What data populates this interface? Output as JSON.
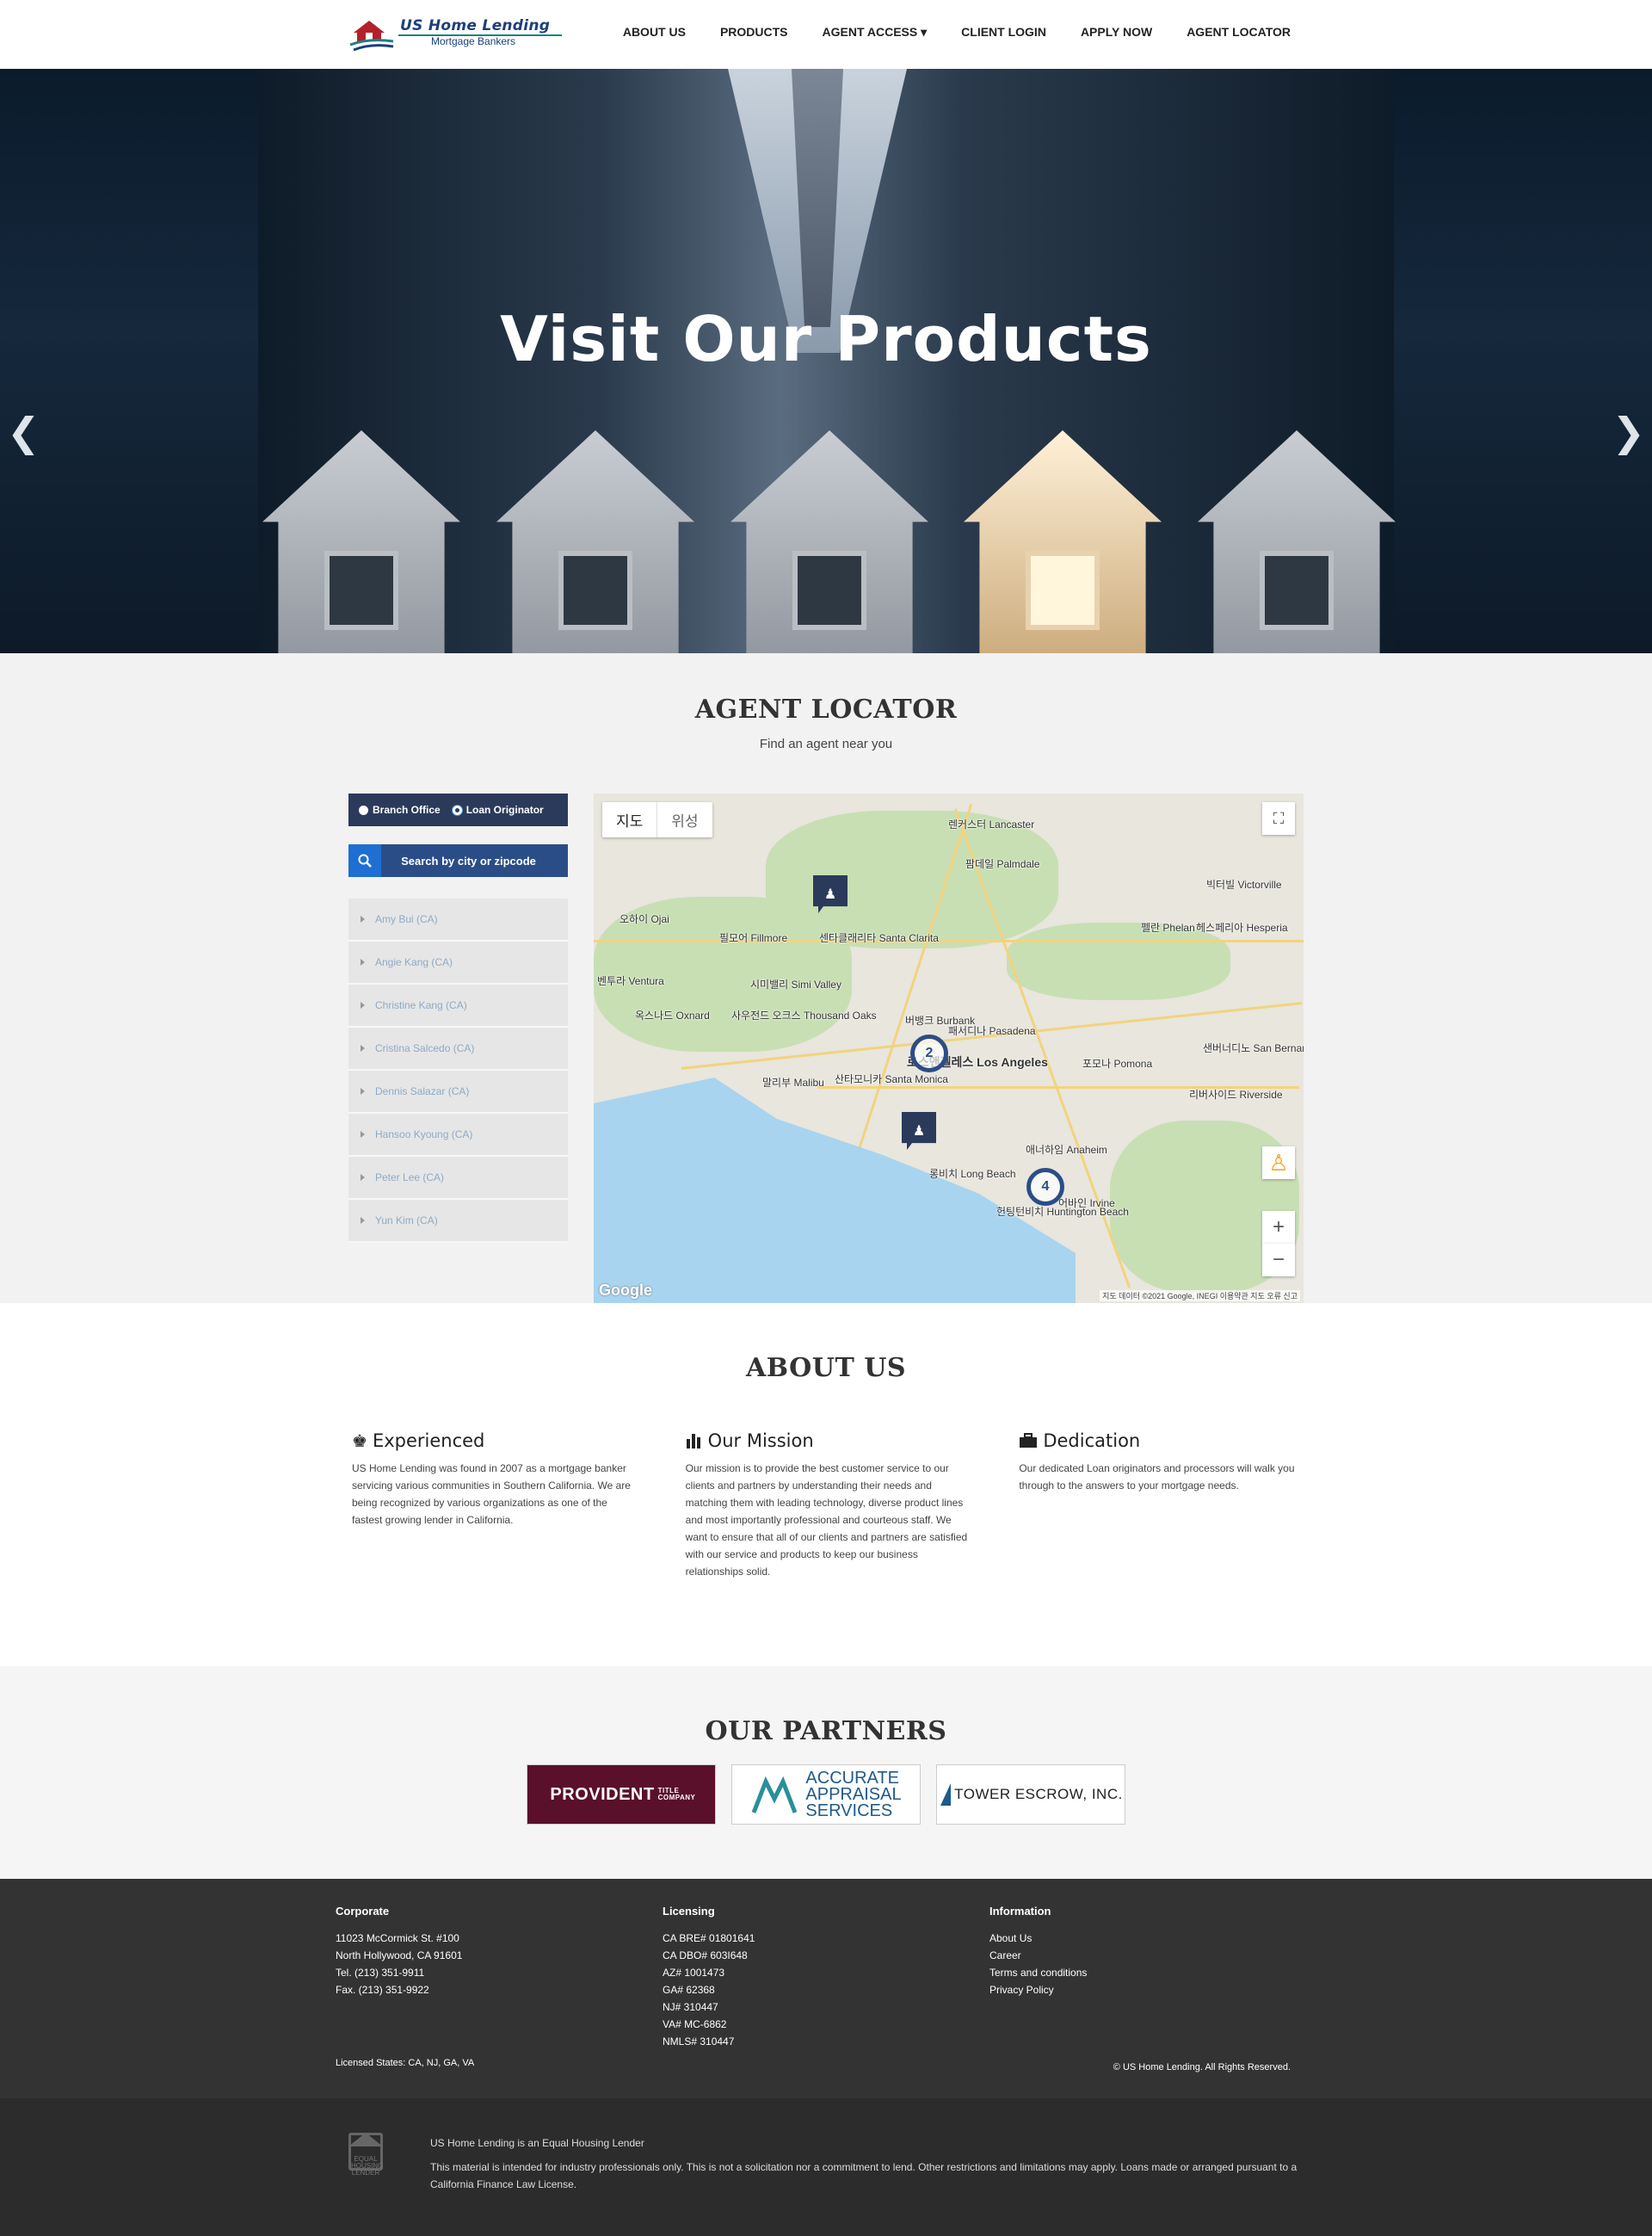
{
  "brand": {
    "title": "US Home Lending",
    "subtitle": "Mortgage Bankers"
  },
  "nav": {
    "items": [
      "ABOUT US",
      "PRODUCTS",
      "AGENT ACCESS ▾",
      "CLIENT LOGIN",
      "APPLY NOW",
      "AGENT LOCATOR"
    ]
  },
  "hero": {
    "title": "Visit Our Products",
    "prev_icon": "chevron-left-icon",
    "next_icon": "chevron-right-icon"
  },
  "locator": {
    "title": "AGENT LOCATOR",
    "subtitle": "Find an agent near you",
    "radio": [
      {
        "label": "Branch Office",
        "selected": false
      },
      {
        "label": "Loan Originator",
        "selected": true
      }
    ],
    "search_placeholder": "Search by city or zipcode",
    "agents": [
      "Amy Bui (CA)",
      "Angie Kang (CA)",
      "Christine Kang (CA)",
      "Cristina Salcedo (CA)",
      "Dennis Salazar (CA)",
      "Hansoo Kyoung (CA)",
      "Peter Lee (CA)",
      "Yun Kim (CA)"
    ]
  },
  "map": {
    "tabs": [
      "지도",
      "위성"
    ],
    "clusters": [
      "2",
      "4"
    ],
    "places": [
      "렌커스터 Lancaster",
      "팜데일 Palmdale",
      "센타클래리타 Santa Clarita",
      "벤투라 Ventura",
      "시미밸리 Simi Valley",
      "사우전드 오크스 Thousand Oaks",
      "버뱅크 Burbank",
      "패서디나 Pasadena",
      "로스앤젤레스 Los Angeles",
      "산타모니카 Santa Monica",
      "포모나 Pomona",
      "샌버너디노 San Bernardino",
      "리버사이드 Riverside",
      "애너하임 Anaheim",
      "롱비치 Long Beach",
      "어바인 Irvine",
      "헌팅턴비치 Huntington Beach",
      "헤스페리아 Hesperia",
      "빅터빌 Victorville",
      "옥스나드 Oxnard",
      "말리부 Malibu",
      "필모어 Fillmore",
      "오하이 Ojai",
      "펠란 Phelan"
    ],
    "google": "Google",
    "attribution": "지도 데이터 ©2021 Google, INEGI   이용약관   지도 오류 신고"
  },
  "about": {
    "title": "ABOUT US",
    "cols": [
      {
        "icon": "chess-king-icon",
        "heading": "Experienced",
        "text": "US Home Lending was found in 2007 as a mortgage banker servicing various communities in Southern California. We are being recognized by various organizations as one of the fastest growing lender in California."
      },
      {
        "icon": "bar-chart-icon",
        "heading": "Our Mission",
        "text": "Our mission is to provide the best customer service to our clients and partners by understanding their needs and matching them with leading technology, diverse product lines and most importantly professional and courteous staff. We want to ensure that all of our clients and partners are satisfied with our service and products to keep our business relationships solid."
      },
      {
        "icon": "briefcase-icon",
        "heading": "Dedication",
        "text": "Our dedicated Loan originators and processors will walk you through to the answers to your mortgage needs."
      }
    ]
  },
  "partners": {
    "title": "OUR PARTNERS",
    "logos": [
      "PROVIDENT",
      "TITLE COMPANY",
      "ACCURATE",
      "APPRAISAL",
      "SERVICES",
      "TOWER ESCROW, INC."
    ]
  },
  "footer": {
    "corporate": {
      "heading": "Corporate",
      "lines": [
        "11023 McCormick St. #100",
        "North Hollywood, CA 91601",
        "Tel. (213) 351-9911",
        "Fax. (213) 351-9922"
      ]
    },
    "licensing": {
      "heading": "Licensing",
      "lines": [
        "CA BRE# 01801641",
        "CA DBO# 603I648",
        "AZ# 1001473",
        "GA# 62368",
        "NJ# 310447",
        "VA# MC-6862",
        "NMLS# 310447"
      ]
    },
    "information": {
      "heading": "Information",
      "links": [
        "About Us",
        "Career",
        "Terms and conditions",
        "Privacy Policy"
      ]
    },
    "licensed_states": "Licensed States: CA, NJ, GA, VA",
    "copyright": "© US Home Lending. All Rights Reserved."
  },
  "bottom": {
    "ehl_logo": "EQUAL HOUSING LENDER",
    "line1": "US Home Lending is an Equal Housing Lender",
    "line2": "This material is intended for industry professionals only. This is not a solicitation nor a commitment to lend. Other restrictions and limitations may apply. Loans made or arranged pursuant to a California Finance Law License."
  },
  "colors": {
    "navy": "#2b3a5b",
    "blue": "#2b4d87",
    "accent": "#1e6fd1",
    "footer": "#333333"
  }
}
